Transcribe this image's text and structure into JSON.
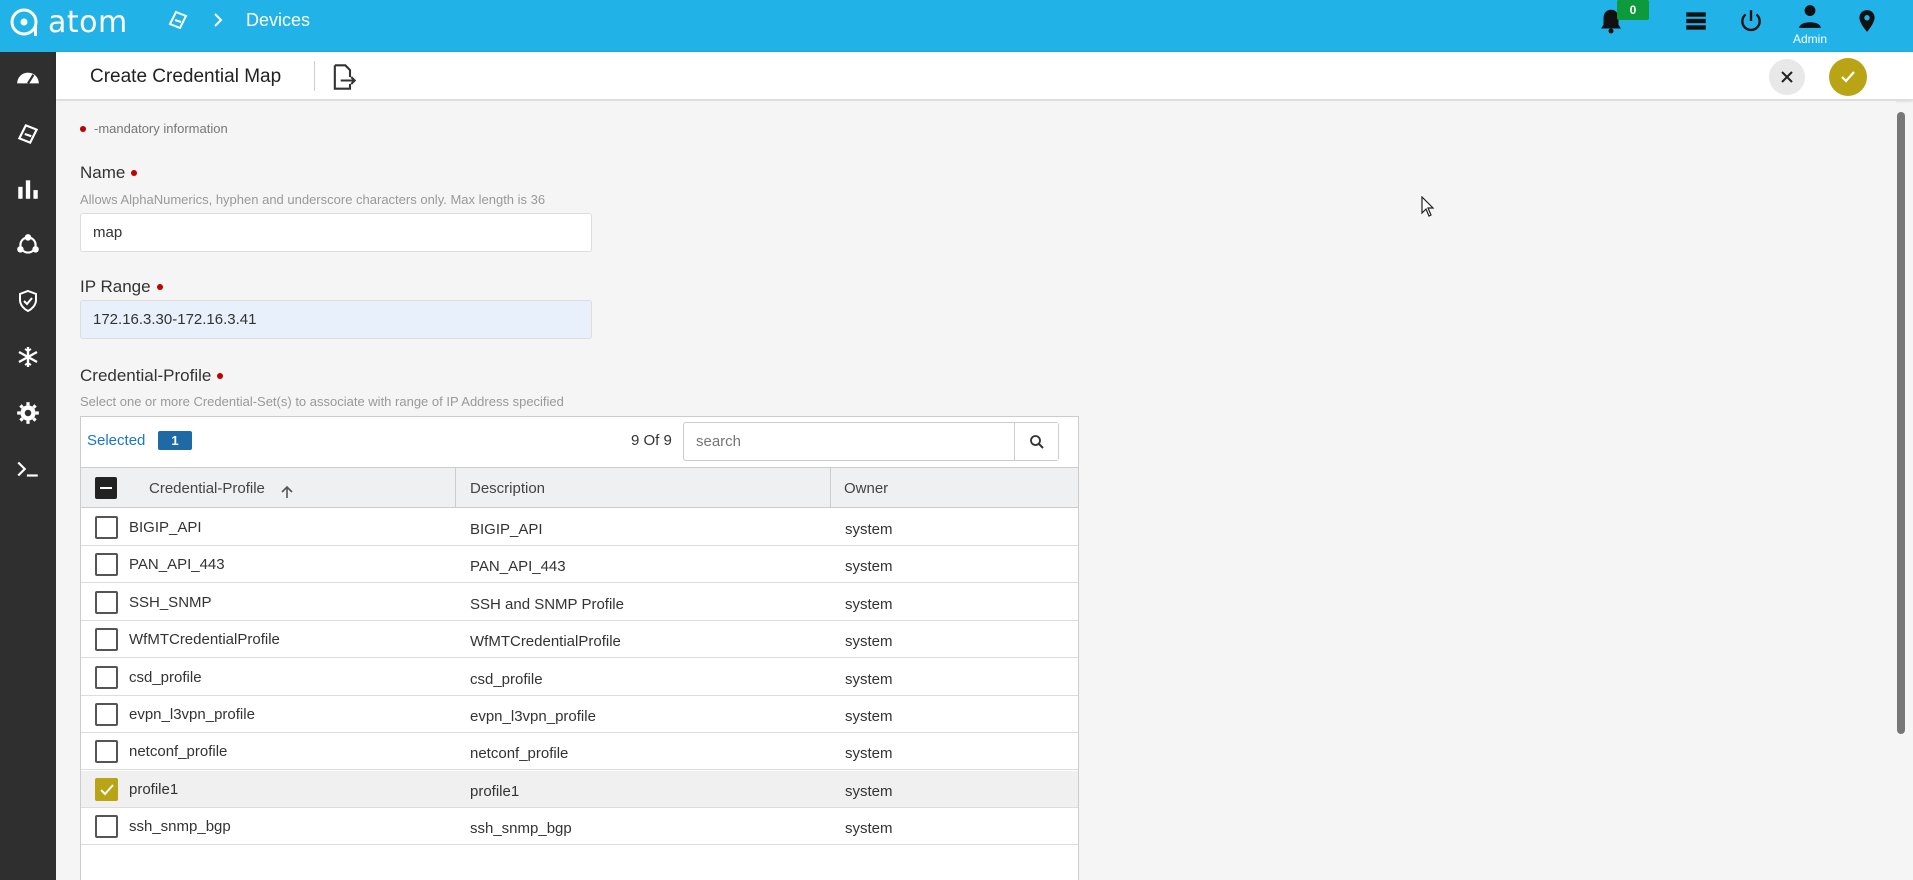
{
  "topbar": {
    "brand": "atom",
    "breadcrumb": "Devices",
    "notification_count": "0",
    "user_label": "Admin"
  },
  "sidebar": {
    "items": [
      {
        "icon": "dashboard-icon"
      },
      {
        "icon": "devices-icon"
      },
      {
        "icon": "analytics-icon"
      },
      {
        "icon": "topology-icon"
      },
      {
        "icon": "security-icon"
      },
      {
        "icon": "snowflake-icon"
      },
      {
        "icon": "settings-icon"
      },
      {
        "icon": "terminal-icon"
      }
    ]
  },
  "header": {
    "title": "Create Credential Map"
  },
  "form": {
    "mandatory_note": "-mandatory information",
    "name": {
      "label": "Name",
      "hint": "Allows AlphaNumerics, hyphen and underscore characters only. Max length is 36",
      "value": "map"
    },
    "ip_range": {
      "label": "IP Range",
      "value": "172.16.3.30-172.16.3.41"
    },
    "credential_profile": {
      "label": "Credential-Profile",
      "hint": "Select one or more Credential-Set(s) to associate with range of IP Address specified"
    }
  },
  "table": {
    "selected_label": "Selected",
    "selected_count": "1",
    "count_text": "9 Of 9",
    "search_placeholder": "search",
    "columns": [
      "Credential-Profile",
      "Description",
      "Owner"
    ],
    "rows": [
      {
        "name": "BIGIP_API",
        "description": "BIGIP_API",
        "owner": "system",
        "checked": false
      },
      {
        "name": "PAN_API_443",
        "description": "PAN_API_443",
        "owner": "system",
        "checked": false
      },
      {
        "name": "SSH_SNMP",
        "description": "SSH and SNMP Profile",
        "owner": "system",
        "checked": false
      },
      {
        "name": "WfMTCredentialProfile",
        "description": "WfMTCredentialProfile",
        "owner": "system",
        "checked": false
      },
      {
        "name": "csd_profile",
        "description": "csd_profile",
        "owner": "system",
        "checked": false
      },
      {
        "name": "evpn_l3vpn_profile",
        "description": "evpn_l3vpn_profile",
        "owner": "system",
        "checked": false
      },
      {
        "name": "netconf_profile",
        "description": "netconf_profile",
        "owner": "system",
        "checked": false
      },
      {
        "name": "profile1",
        "description": "profile1",
        "owner": "system",
        "checked": true
      },
      {
        "name": "ssh_snmp_bgp",
        "description": "ssh_snmp_bgp",
        "owner": "system",
        "checked": false
      }
    ]
  },
  "colors": {
    "topbar": "#21b2e8",
    "sidebar": "#2f2f2f",
    "accent": "#b8a414",
    "mandatory_dot": "#c00000"
  }
}
